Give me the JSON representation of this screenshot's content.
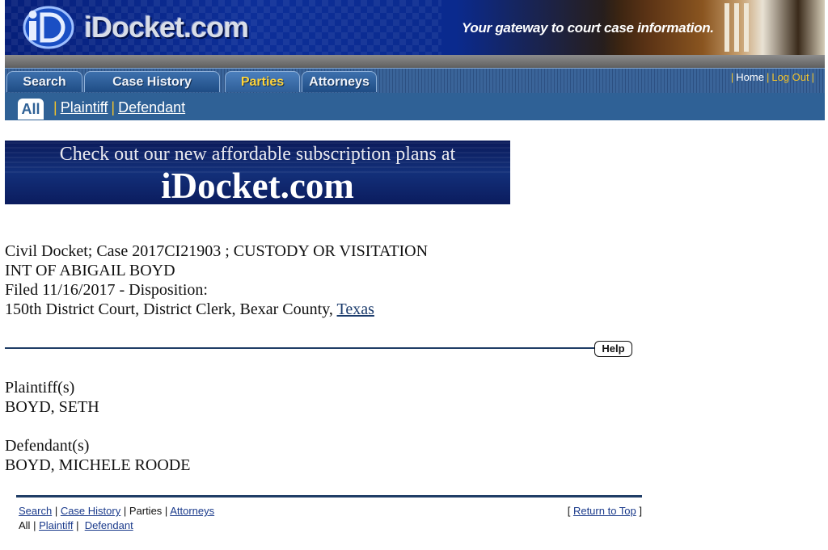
{
  "header": {
    "logo_text": "iDocket.com",
    "tagline_your": "Your",
    "tagline_rest": "gateway to court case information."
  },
  "tabs": [
    {
      "label": "Search"
    },
    {
      "label": "Case History"
    },
    {
      "label": "Parties",
      "active": true
    },
    {
      "label": "Attorneys"
    }
  ],
  "top_links": {
    "home": "Home",
    "logout": "Log Out"
  },
  "subtabs": {
    "all": "All",
    "plaintiff": "Plaintiff",
    "defendant": "Defendant"
  },
  "promo": {
    "line1": "Check out our new affordable subscription plans at",
    "line2": "iDocket.com"
  },
  "case": {
    "line1": "Civil Docket; Case 2017CI21903 ; CUSTODY OR VISITATION",
    "line2": "INT OF ABIGAIL BOYD",
    "line3": "Filed 11/16/2017 - Disposition:",
    "line4_prefix": "150th District Court, District Clerk, Bexar County, ",
    "state_link": "Texas"
  },
  "help_label": "Help",
  "plaintiffs": {
    "heading": "Plaintiff(s)",
    "names": [
      "BOYD, SETH"
    ]
  },
  "defendants": {
    "heading": "Defendant(s)",
    "names": [
      "BOYD, MICHELE ROODE"
    ]
  },
  "footer": {
    "search": "Search",
    "case_history": "Case History",
    "parties": "Parties",
    "attorneys": "Attorneys",
    "all": "All",
    "plaintiff": "Plaintiff",
    "defendant": "Defendant",
    "return_top": "Return to Top"
  },
  "colors": {
    "nav_blue": "#2f6196",
    "tab_active_text": "#ffd43a",
    "rule": "#1f3d66"
  }
}
